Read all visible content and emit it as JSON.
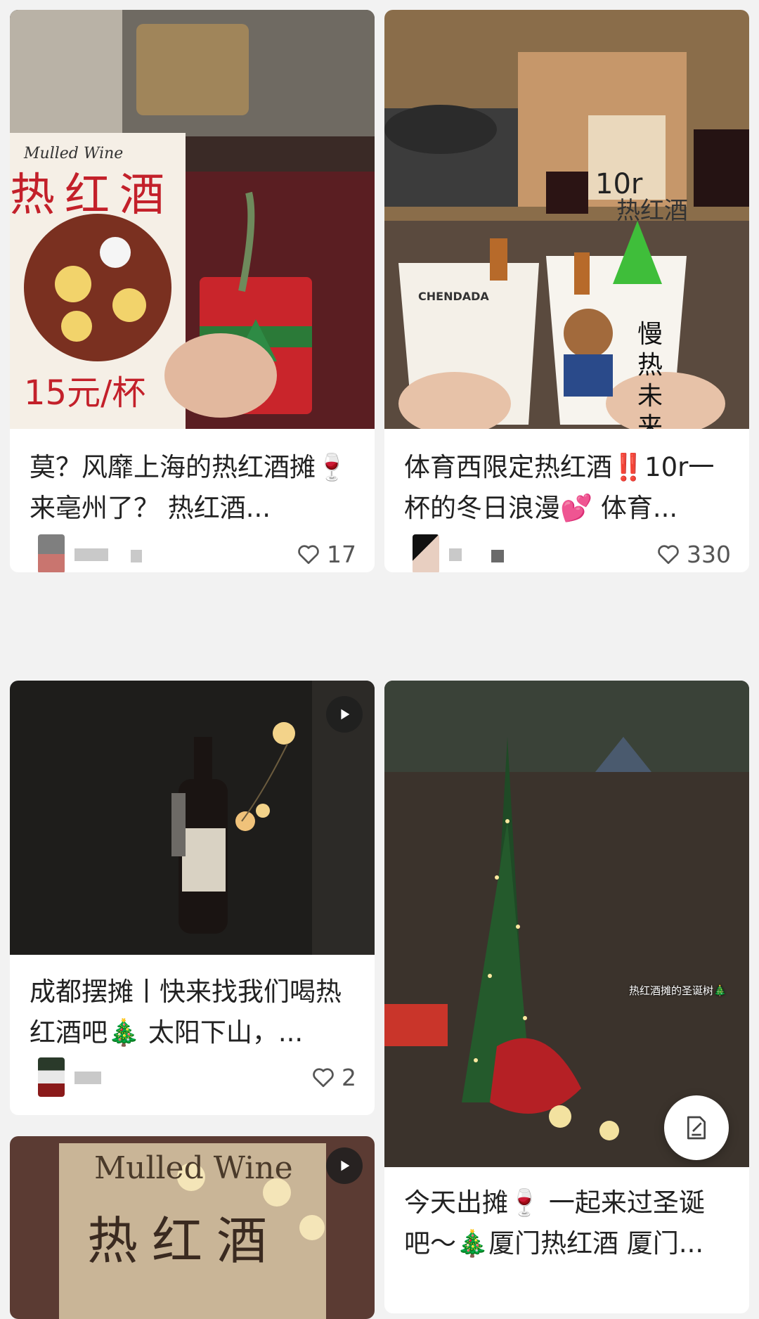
{
  "colors": {
    "page_bg": "#f2f2f2",
    "card_bg": "#ffffff",
    "text": "#222222",
    "muted": "#555555"
  },
  "posts": [
    {
      "title": "莫？风靡上海的热红酒摊🍷来亳州了？ 热红酒...",
      "likes": "17",
      "image_text": {
        "sign_en": "Mulled Wine",
        "sign_cn": "热红酒",
        "price": "15元/杯"
      }
    },
    {
      "title": "体育西限定热红酒‼️10r一杯的冬日浪漫💕 体育...",
      "likes": "330",
      "image_text": {
        "sign_price": "10r",
        "sign_cn": "热红酒",
        "cup_text": "CHENDADA",
        "cup_cn": "慢热未来"
      }
    },
    {
      "title": "成都摆摊丨快来找我们喝热红酒吧🎄 太阳下山，...",
      "likes": "2",
      "has_video": true
    },
    {
      "title": "今天出摊🍷 一起来过圣诞吧～🎄厦门热红酒 厦门...",
      "image_text": {
        "caption": "热红酒摊的圣诞树🎄"
      }
    },
    {
      "has_video": true,
      "image_text": {
        "sign_en": "Mulled Wine",
        "sign_cn": "热红酒"
      }
    }
  ],
  "icons": {
    "like": "heart-outline-icon",
    "play": "play-icon",
    "compose": "compose-icon"
  }
}
